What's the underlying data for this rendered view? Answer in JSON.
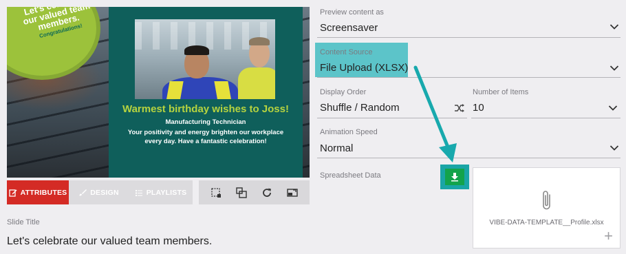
{
  "preview": {
    "badge_line1": "Let's celebrate",
    "badge_line2": "our valued team",
    "badge_line3": "members.",
    "badge_sub": "Congratulations!",
    "headline": "Warmest birthday wishes to Joss!",
    "role": "Manufacturing Technician",
    "message": "Your positivity and energy brighten our workplace every day. Have a fantastic celebration!"
  },
  "tabs": [
    {
      "label": "ATTRIBUTES",
      "icon": "edit-icon",
      "active": true
    },
    {
      "label": "DESIGN",
      "icon": "brush-icon",
      "active": false
    },
    {
      "label": "PLAYLISTS",
      "icon": "list-icon",
      "active": false
    }
  ],
  "tools": [
    "crop-icon",
    "resize-icon",
    "refresh-icon",
    "swap-screen-icon"
  ],
  "slide": {
    "label": "Slide Title",
    "value": "Let's celebrate our valued team members."
  },
  "form": {
    "preview_as": {
      "label": "Preview content as",
      "value": "Screensaver"
    },
    "content_source": {
      "label": "Content Source",
      "value": "File Upload (XLSX)"
    },
    "display_order": {
      "label": "Display Order",
      "value": "Shuffle / Random"
    },
    "number_items": {
      "label": "Number of Items",
      "value": "10"
    },
    "animation_speed": {
      "label": "Animation Speed",
      "value": "Normal"
    },
    "spreadsheet": {
      "label": "Spreadsheet Data",
      "file_name": "VIBE-DATA-TEMPLATE__Profile.xlsx"
    }
  },
  "colors": {
    "accent_red": "#d42b25",
    "highlight_teal": "#5cc4c9",
    "arrow_teal": "#18a9ad",
    "download_green": "#13a34b",
    "panel_teal": "#0f5f5b",
    "headline_green": "#b6d33f"
  }
}
